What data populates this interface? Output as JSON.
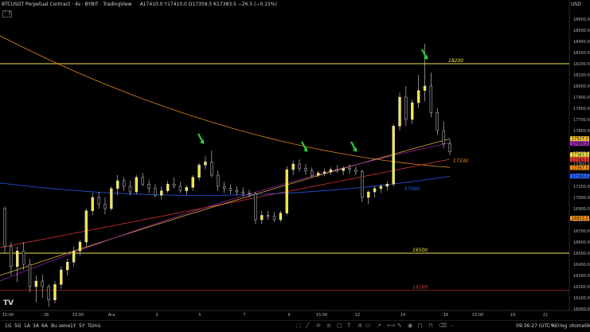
{
  "header": {
    "title": "BTCUSDT Perpetual Contract · 4s · BYBIT · TradingView",
    "ohlc": "A17410.0  Y17410.0  D17359.5  K17383.5  −26.5 (−0.15%)"
  },
  "currency": "USD",
  "collapse_label": "⌃ 3",
  "logo_text": "TV",
  "chart_data": {
    "type": "candlestick",
    "ylim": [
      16000,
      18700
    ],
    "y_ticks": [
      18600,
      18500,
      18400,
      18300,
      18200,
      18100,
      18000,
      17900,
      17800,
      17700,
      17600,
      17500,
      17400,
      17300,
      17200,
      17100,
      17000,
      16900,
      16800,
      16700,
      16600,
      16500,
      16400,
      16300,
      16200,
      16100,
      16000
    ],
    "x_ticks": [
      "15:00",
      "28",
      "15:00",
      "Ara",
      "3",
      "5",
      "7",
      "9",
      "15:00",
      "12",
      "14",
      "16",
      "15:00",
      "19",
      "21"
    ],
    "horizontal_lines": [
      {
        "label": "18200",
        "value": 18200,
        "color": "#f5e642"
      },
      {
        "label": "16500",
        "value": 16500,
        "color": "#f5e642"
      },
      {
        "label": "16169",
        "value": 16169,
        "color": "#c0392b"
      }
    ],
    "annotations": [
      {
        "label": "17330",
        "value": 17330,
        "color": "#f7931a"
      },
      {
        "label": "17080",
        "value": 17080,
        "color": "#2962ff"
      }
    ],
    "price_badges": [
      {
        "label": "17527.0",
        "value": 17527,
        "color": "#f7c33a"
      },
      {
        "label": "17490.5",
        "value": 17490.5,
        "color": "#9c27b0"
      },
      {
        "label": "17383.5",
        "value": 17383.5,
        "color": "#f5e642"
      },
      {
        "label": "17343.0",
        "value": 17343,
        "color": "#e53935"
      },
      {
        "label": "17267.5",
        "value": 17267.5,
        "color": "#f7931a"
      },
      {
        "label": "17190.5",
        "value": 17190.5,
        "color": "#2962ff"
      },
      {
        "label": "16813.0",
        "value": 16813,
        "color": "#f7931a"
      }
    ],
    "candles": [
      [
        16900,
        16920,
        16500,
        16560
      ],
      [
        16560,
        16600,
        16300,
        16380
      ],
      [
        16380,
        16560,
        16240,
        16520
      ],
      [
        16520,
        16600,
        16350,
        16400
      ],
      [
        16400,
        16450,
        16150,
        16200
      ],
      [
        16200,
        16300,
        16060,
        16250
      ],
      [
        16250,
        16310,
        16100,
        16200
      ],
      [
        16200,
        16220,
        16020,
        16080
      ],
      [
        16080,
        16250,
        16050,
        16220
      ],
      [
        16220,
        16380,
        16180,
        16350
      ],
      [
        16350,
        16450,
        16300,
        16420
      ],
      [
        16420,
        16560,
        16380,
        16520
      ],
      [
        16520,
        16620,
        16480,
        16600
      ],
      [
        16600,
        16900,
        16560,
        16880
      ],
      [
        16880,
        17040,
        16840,
        17000
      ],
      [
        17000,
        17050,
        16900,
        16940
      ],
      [
        16940,
        17000,
        16850,
        16900
      ],
      [
        16900,
        17100,
        16880,
        17080
      ],
      [
        17080,
        17200,
        17020,
        17150
      ],
      [
        17150,
        17180,
        17060,
        17100
      ],
      [
        17100,
        17150,
        17020,
        17050
      ],
      [
        17050,
        17200,
        17030,
        17180
      ],
      [
        17180,
        17220,
        17100,
        17120
      ],
      [
        17120,
        17160,
        17040,
        17080
      ],
      [
        17080,
        17120,
        17000,
        17020
      ],
      [
        17020,
        17100,
        16980,
        17060
      ],
      [
        17060,
        17150,
        17040,
        17120
      ],
      [
        17120,
        17180,
        17080,
        17100
      ],
      [
        17100,
        17140,
        17040,
        17060
      ],
      [
        17060,
        17110,
        17020,
        17090
      ],
      [
        17090,
        17200,
        17060,
        17180
      ],
      [
        17180,
        17310,
        17150,
        17290
      ],
      [
        17290,
        17370,
        17250,
        17320
      ],
      [
        17320,
        17420,
        17180,
        17200
      ],
      [
        17200,
        17240,
        17060,
        17100
      ],
      [
        17100,
        17140,
        17040,
        17080
      ],
      [
        17080,
        17120,
        17030,
        17060
      ],
      [
        17060,
        17100,
        17020,
        17050
      ],
      [
        17050,
        17090,
        17010,
        17040
      ],
      [
        17040,
        17070,
        17000,
        17030
      ],
      [
        17030,
        17050,
        16760,
        16800
      ],
      [
        16800,
        16880,
        16760,
        16840
      ],
      [
        16840,
        16880,
        16800,
        16830
      ],
      [
        16830,
        16870,
        16780,
        16800
      ],
      [
        16800,
        16880,
        16780,
        16860
      ],
      [
        16860,
        17280,
        16840,
        17250
      ],
      [
        17250,
        17330,
        17200,
        17300
      ],
      [
        17300,
        17340,
        17230,
        17260
      ],
      [
        17260,
        17300,
        17200,
        17240
      ],
      [
        17240,
        17270,
        17180,
        17200
      ],
      [
        17200,
        17240,
        17180,
        17220
      ],
      [
        17220,
        17260,
        17190,
        17230
      ],
      [
        17230,
        17270,
        17200,
        17250
      ],
      [
        17250,
        17290,
        17220,
        17240
      ],
      [
        17240,
        17280,
        17200,
        17260
      ],
      [
        17260,
        17300,
        17210,
        17250
      ],
      [
        17250,
        17280,
        17200,
        17230
      ],
      [
        17230,
        17250,
        16960,
        17000
      ],
      [
        17000,
        17060,
        16940,
        17050
      ],
      [
        17050,
        17100,
        17000,
        17080
      ],
      [
        17080,
        17120,
        17040,
        17100
      ],
      [
        17100,
        17140,
        17060,
        17120
      ],
      [
        17120,
        17660,
        17100,
        17640
      ],
      [
        17640,
        17940,
        17600,
        17900
      ],
      [
        17900,
        18000,
        17640,
        17700
      ],
      [
        17700,
        17880,
        17660,
        17850
      ],
      [
        17850,
        18100,
        17800,
        17960
      ],
      [
        17960,
        18380,
        17860,
        18000
      ],
      [
        18000,
        18120,
        17720,
        17760
      ],
      [
        17760,
        17800,
        17560,
        17600
      ],
      [
        17600,
        17680,
        17440,
        17480
      ],
      [
        17480,
        17520,
        17380,
        17410
      ]
    ],
    "ma_series": [
      {
        "color": "#f7931a",
        "from": 18450,
        "mid": 17420,
        "to": 17270
      },
      {
        "color": "#e53935",
        "from": 16550,
        "mid": 16940,
        "to": 17343
      },
      {
        "color": "#2962ff",
        "from": 17130,
        "mid": 16880,
        "to": 17190
      },
      {
        "color": "#f7c33a",
        "from": 16300,
        "mid": 16980,
        "to": 17527
      },
      {
        "color": "#9c27b0",
        "from": 16250,
        "mid": 17060,
        "to": 17490
      }
    ]
  },
  "bottom": {
    "timeframes": [
      "1G",
      "5G",
      "1A",
      "3A",
      "6A",
      "Bu sene",
      "1Y",
      "5Y",
      "Tümü"
    ],
    "clock": "09:36:27 (UTC+3)",
    "percent": "%",
    "log": "log",
    "auto": "otomatik"
  }
}
